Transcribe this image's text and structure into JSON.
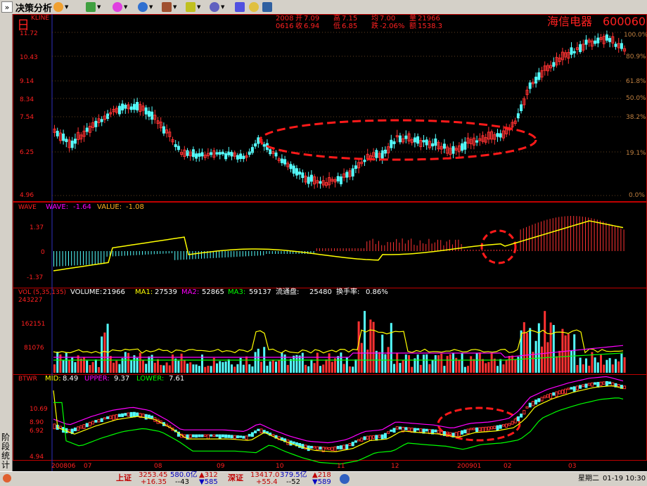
{
  "toolbar": {
    "expand_glyph": "»",
    "title": "决策分析",
    "icons": [
      "home-icon",
      "chart-icon",
      "globe-icon",
      "tools-icon",
      "flag-icon",
      "gear-icon",
      "info-icon",
      "help-icon"
    ]
  },
  "sidebar": {
    "label": "阶段统计"
  },
  "header": {
    "period_char": "日",
    "chart_type": "KLINE",
    "year": "2008",
    "date": "0616",
    "open_label": "开",
    "open": "7.09",
    "close_label": "收",
    "close": "6.94",
    "high_label": "高",
    "high": "7.15",
    "low_label": "低",
    "low": "6.85",
    "avg_label": "均",
    "avg": "7.00",
    "change_label": "跌",
    "change": "-2.06%",
    "volume_label": "量",
    "volume": "21966",
    "amount_label": "额",
    "amount": "1538.3",
    "stock_name": "海信电器",
    "stock_code": "600060"
  },
  "price_panel": {
    "y_ticks": [
      "11.72",
      "10.43",
      "9.14",
      "8.34",
      "7.54",
      "6.25",
      "4.96"
    ],
    "percent_ticks": [
      "100.0%",
      "80.9%",
      "61.8%",
      "50.0%",
      "38.2%",
      "19.1%",
      "0.0%"
    ]
  },
  "wave_panel": {
    "name": "WAVE",
    "wave_label": "WAVE:",
    "wave_value": "-1.64",
    "value_label": "VALUE:",
    "value_value": "-1.08",
    "y_ticks": [
      "1.37",
      "0",
      "-1.37"
    ]
  },
  "vol_panel": {
    "name": "VOL (5,35,135)",
    "volume_label": "VOLUME:",
    "volume_value": "21966",
    "ma1_label": "MA1:",
    "ma1_value": "27539",
    "ma2_label": "MA2:",
    "ma2_value": "52865",
    "ma3_label": "MA3:",
    "ma3_value": "59137",
    "float_label": "流通盘:",
    "float_value": "25480",
    "turnover_label": "换手率:",
    "turnover_value": "0.86%",
    "y_ticks": [
      "243227",
      "162151",
      "81076"
    ]
  },
  "btwr_panel": {
    "name": "BTWR",
    "mid_label": "MID:",
    "mid_value": "8.49",
    "upper_label": "UPPER:",
    "upper_value": "9.37",
    "lower_label": "LOWER:",
    "lower_value": "7.61",
    "y_ticks": [
      "10.69",
      "8.90",
      "6.92",
      "4.94"
    ]
  },
  "date_axis": [
    "200806",
    "07",
    "08",
    "09",
    "10",
    "11",
    "12",
    "200901",
    "02",
    "03"
  ],
  "status": {
    "sh_label": "上证",
    "sh_index": "3253.45",
    "sh_change": "+16.35",
    "sh_amount": "580.0亿",
    "sh_mid": "--43",
    "sh_up": "▲312",
    "sh_down": "▼585",
    "sz_label": "深证",
    "sz_index": "13417.0",
    "sz_change": "+55.4",
    "sz_amount": "379.5亿",
    "sz_mid": "--52",
    "sz_up": "▲218",
    "sz_down": "▼589",
    "weekday": "星期二",
    "datetime": "01-19 10:30"
  },
  "colors": {
    "up": "#ff3232",
    "down": "#54ffff",
    "axis_red": "#c00000",
    "ma1": "#ffff00",
    "ma2": "#ff00ff",
    "ma3": "#00ff00"
  }
}
